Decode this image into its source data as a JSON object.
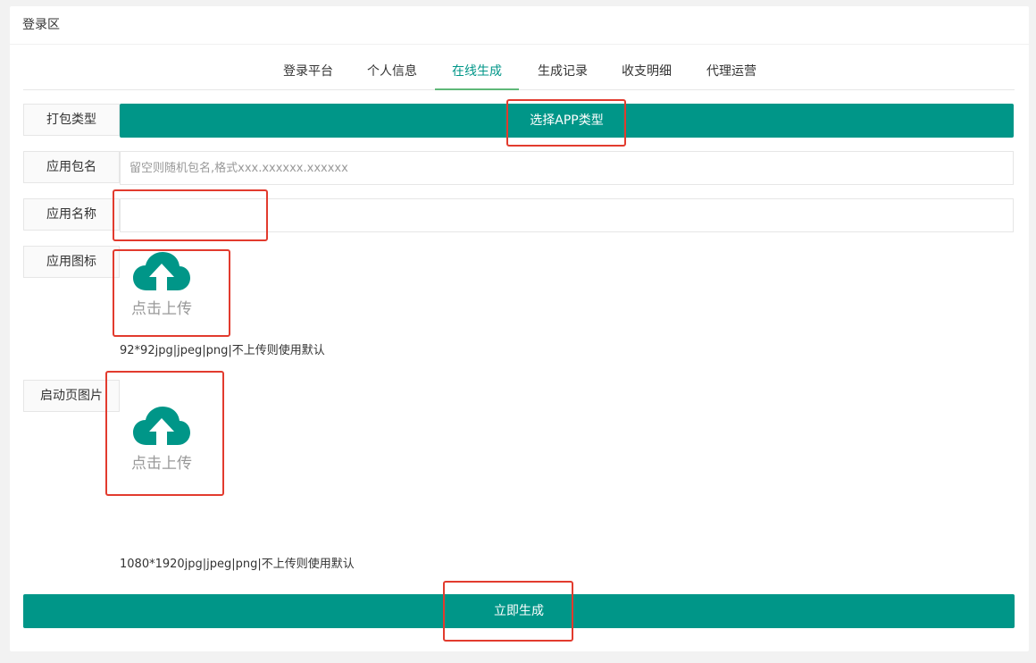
{
  "card": {
    "title": "登录区"
  },
  "tabs": [
    {
      "label": "登录平台"
    },
    {
      "label": "个人信息"
    },
    {
      "label": "在线生成"
    },
    {
      "label": "生成记录"
    },
    {
      "label": "收支明细"
    },
    {
      "label": "代理运营"
    }
  ],
  "active_tab": "在线生成",
  "form": {
    "pack_type": {
      "label": "打包类型",
      "button": "选择APP类型"
    },
    "package_name": {
      "label": "应用包名",
      "placeholder": "留空则随机包名,格式xxx.xxxxxx.xxxxxx",
      "value": ""
    },
    "app_name": {
      "label": "应用名称",
      "value": ""
    },
    "app_icon": {
      "label": "应用图标",
      "upload_text": "点击上传",
      "hint": "92*92jpg|jpeg|png|不上传则使用默认"
    },
    "splash": {
      "label": "启动页图片",
      "upload_text": "点击上传",
      "hint": "1080*1920jpg|jpeg|png|不上传则使用默认"
    },
    "submit": "立即生成"
  },
  "colors": {
    "primary": "#009688",
    "tab_underline": "#5FB878",
    "annotation": "#e23b2e"
  }
}
